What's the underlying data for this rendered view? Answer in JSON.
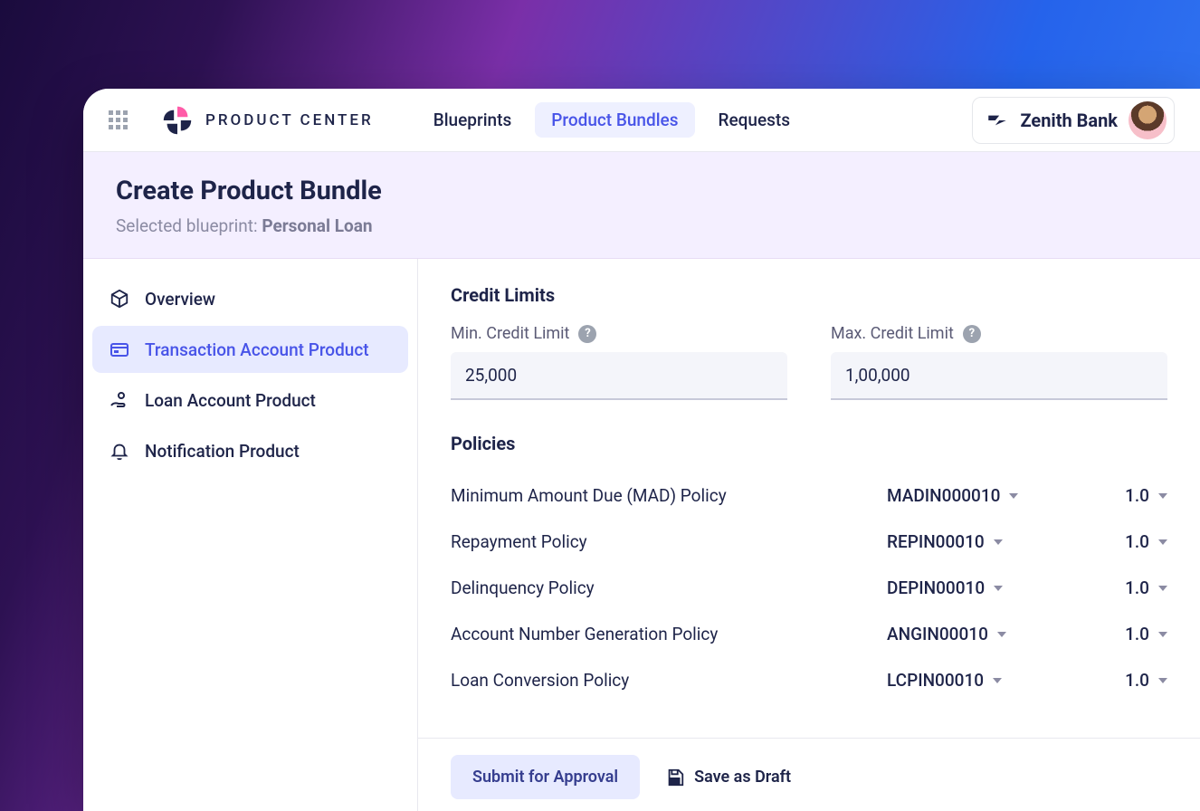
{
  "header": {
    "app_name": "PRODUCT CENTER",
    "nav": [
      {
        "label": "Blueprints",
        "active": false
      },
      {
        "label": "Product Bundles",
        "active": true
      },
      {
        "label": "Requests",
        "active": false
      }
    ],
    "org_name": "Zenith Bank"
  },
  "subheader": {
    "title": "Create Product Bundle",
    "blueprint_prefix": "Selected blueprint: ",
    "blueprint_name": "Personal Loan"
  },
  "sidebar": {
    "items": [
      {
        "label": "Overview",
        "icon": "cube-icon",
        "active": false
      },
      {
        "label": "Transaction Account Product",
        "icon": "card-icon",
        "active": true
      },
      {
        "label": "Loan Account Product",
        "icon": "hand-coin-icon",
        "active": false
      },
      {
        "label": "Notification Product",
        "icon": "bell-icon",
        "active": false
      }
    ]
  },
  "main": {
    "credit_section_title": "Credit Limits",
    "min_label": "Min. Credit Limit",
    "min_value": "25,000",
    "max_label": "Max. Credit Limit",
    "max_value": "1,00,000",
    "policies_title": "Policies",
    "policies": [
      {
        "name": "Minimum Amount Due (MAD) Policy",
        "code": "MADIN000010",
        "version": "1.0"
      },
      {
        "name": "Repayment Policy",
        "code": "REPIN00010",
        "version": "1.0"
      },
      {
        "name": "Delinquency Policy",
        "code": "DEPIN00010",
        "version": "1.0"
      },
      {
        "name": "Account Number Generation Policy",
        "code": "ANGIN00010",
        "version": "1.0"
      },
      {
        "name": "Loan Conversion Policy",
        "code": "LCPIN00010",
        "version": "1.0"
      }
    ]
  },
  "footer": {
    "submit_label": "Submit for Approval",
    "save_label": "Save as Draft"
  }
}
